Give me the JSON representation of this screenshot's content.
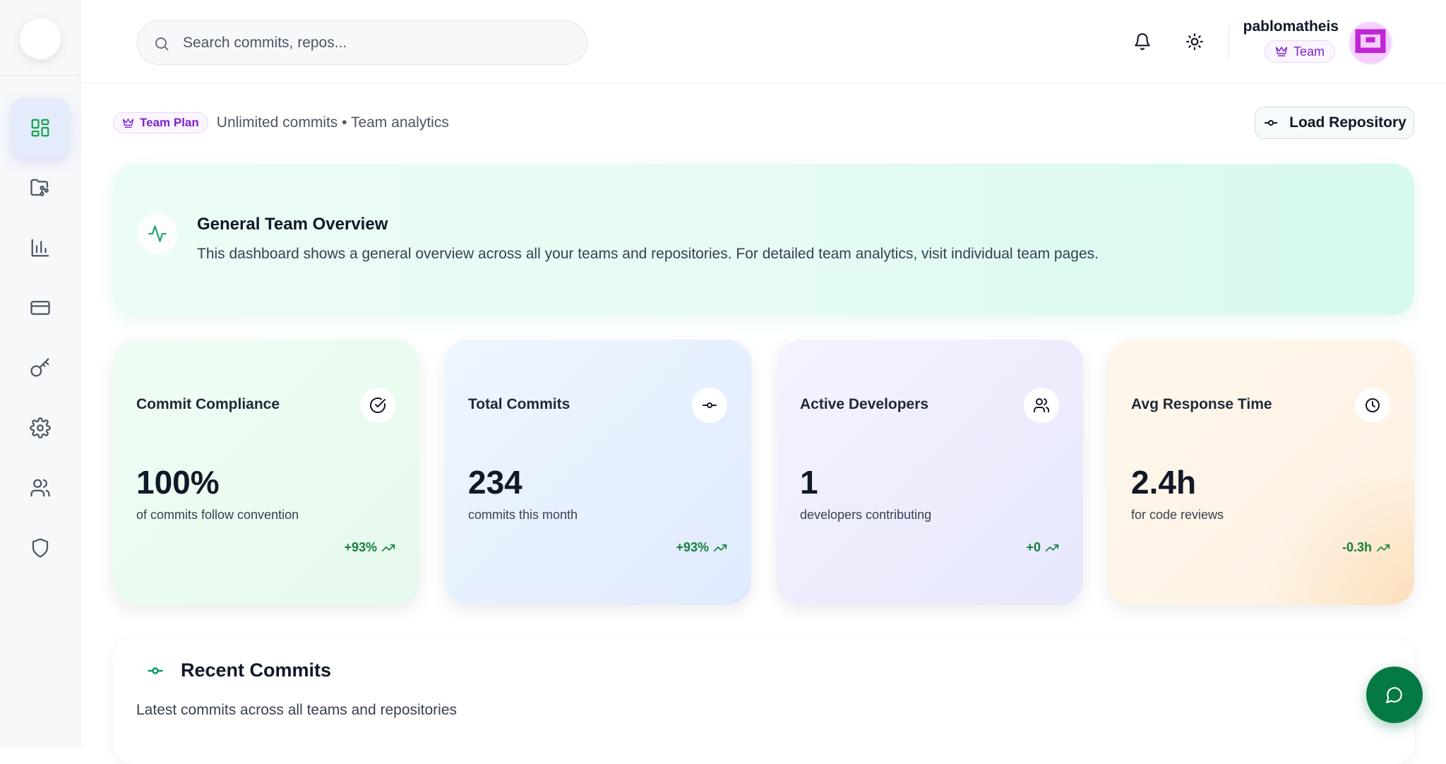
{
  "search": {
    "placeholder": "Search commits, repos..."
  },
  "user": {
    "name": "pablomatheis",
    "plan": "Team"
  },
  "sidebar": {
    "items": [
      {
        "name": "dashboard-icon",
        "active": true
      },
      {
        "name": "repositories-icon"
      },
      {
        "name": "analytics-icon"
      },
      {
        "name": "billing-icon"
      },
      {
        "name": "api-keys-icon"
      },
      {
        "name": "settings-icon"
      },
      {
        "name": "teams-icon"
      },
      {
        "name": "security-icon"
      }
    ]
  },
  "topbar": {
    "plan_badge": "Team Plan",
    "plan_features": "Unlimited commits • Team analytics",
    "load_button": "Load Repository"
  },
  "overview": {
    "title": "General Team Overview",
    "description": "This dashboard shows a general overview across all your teams and repositories. For detailed team analytics, visit individual team pages."
  },
  "stats": [
    {
      "title": "Commit Compliance",
      "value": "100%",
      "subtitle": "of commits follow convention",
      "trend": "+93%",
      "icon": "check-circle-icon"
    },
    {
      "title": "Total Commits",
      "value": "234",
      "subtitle": "commits this month",
      "trend": "+93%",
      "icon": "commit-icon"
    },
    {
      "title": "Active Developers",
      "value": "1",
      "subtitle": "developers contributing",
      "trend": "+0",
      "icon": "users-icon"
    },
    {
      "title": "Avg Response Time",
      "value": "2.4h",
      "subtitle": "for code reviews",
      "trend": "-0.3h",
      "icon": "clock-icon"
    }
  ],
  "recent": {
    "title": "Recent Commits",
    "subtitle": "Latest commits across all teams and repositories"
  },
  "colors": {
    "accent_green": "#16a34a",
    "plan_purple": "#7e22ce",
    "fab_green": "#047a42"
  }
}
